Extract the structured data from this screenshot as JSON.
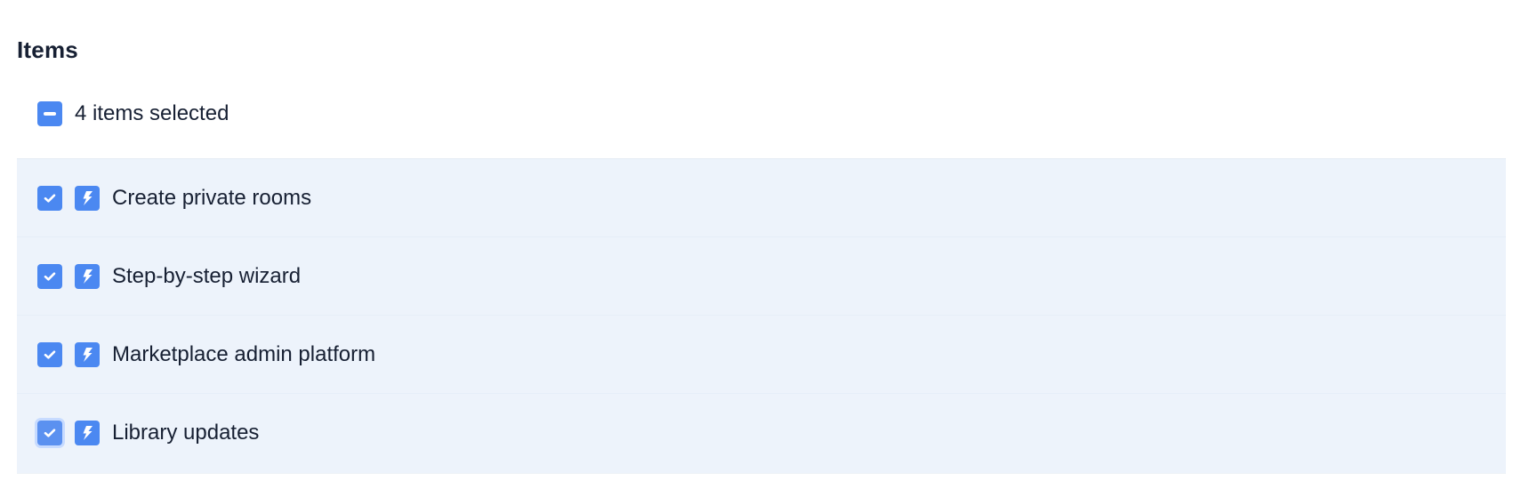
{
  "section": {
    "title": "Items"
  },
  "selection": {
    "summary_label": "4 items selected"
  },
  "items": [
    {
      "label": "Create private rooms",
      "icon": "bolt-icon",
      "checked": true
    },
    {
      "label": "Step-by-step wizard",
      "icon": "bolt-icon",
      "checked": true
    },
    {
      "label": "Marketplace admin platform",
      "icon": "bolt-icon",
      "checked": true
    },
    {
      "label": "Library updates",
      "icon": "bolt-icon",
      "checked": true
    }
  ],
  "colors": {
    "accent": "#4b88f1",
    "selected_row_background": "#edf3fb",
    "text": "#172033"
  }
}
